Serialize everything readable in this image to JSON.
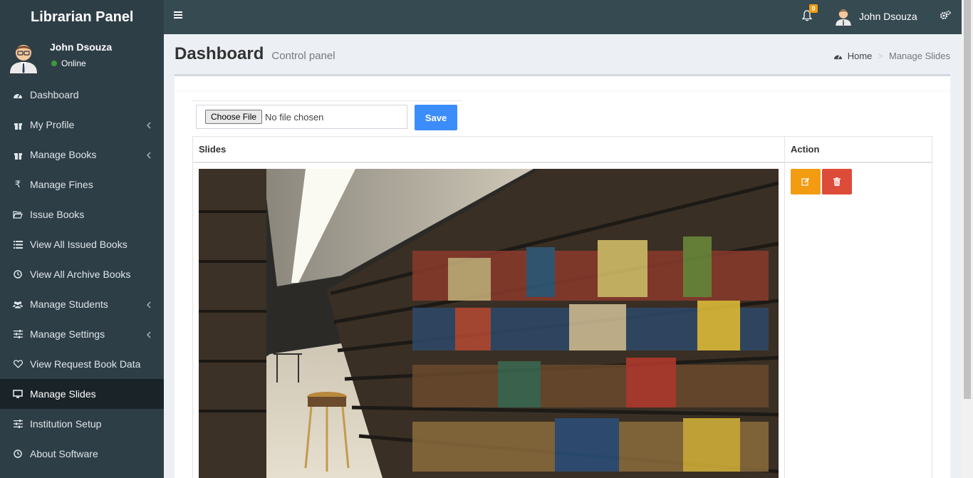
{
  "app": {
    "brand": "Librarian Panel"
  },
  "user": {
    "name": "John Dsouza",
    "status": "Online"
  },
  "notifications": {
    "count": "0"
  },
  "sidebar": {
    "items": [
      {
        "label": "Dashboard",
        "icon": "dashboard-icon",
        "has_submenu": false
      },
      {
        "label": "My Profile",
        "icon": "gift-icon",
        "has_submenu": true
      },
      {
        "label": "Manage Books",
        "icon": "gift-icon",
        "has_submenu": true
      },
      {
        "label": "Manage Fines",
        "icon": "rupee-icon",
        "has_submenu": false
      },
      {
        "label": "Issue Books",
        "icon": "folder-open-icon",
        "has_submenu": false
      },
      {
        "label": "View All Issued Books",
        "icon": "list-icon",
        "has_submenu": false
      },
      {
        "label": "View All Archive Books",
        "icon": "clock-icon",
        "has_submenu": false
      },
      {
        "label": "Manage Students",
        "icon": "users-icon",
        "has_submenu": true
      },
      {
        "label": "Manage Settings",
        "icon": "sliders-icon",
        "has_submenu": true
      },
      {
        "label": "View Request Book Data",
        "icon": "heart-icon",
        "has_submenu": false
      },
      {
        "label": "Manage Slides",
        "icon": "desktop-icon",
        "has_submenu": false,
        "active": true
      },
      {
        "label": "Institution Setup",
        "icon": "sliders-icon",
        "has_submenu": false
      },
      {
        "label": "About Software",
        "icon": "clock-icon",
        "has_submenu": false
      }
    ]
  },
  "header": {
    "title": "Dashboard",
    "subtitle": "Control panel"
  },
  "breadcrumb": {
    "home": "Home",
    "current": "Manage Slides"
  },
  "upload": {
    "choose_label": "Choose File",
    "file_status": "No file chosen",
    "save_label": "Save"
  },
  "table": {
    "columns": [
      "Slides",
      "Action"
    ]
  },
  "colors": {
    "sidebar_bg": "#2e3e46",
    "navbar_bg": "#364a52",
    "save": "#3c8dfc",
    "edit": "#f39c12",
    "delete": "#dd4b39"
  }
}
